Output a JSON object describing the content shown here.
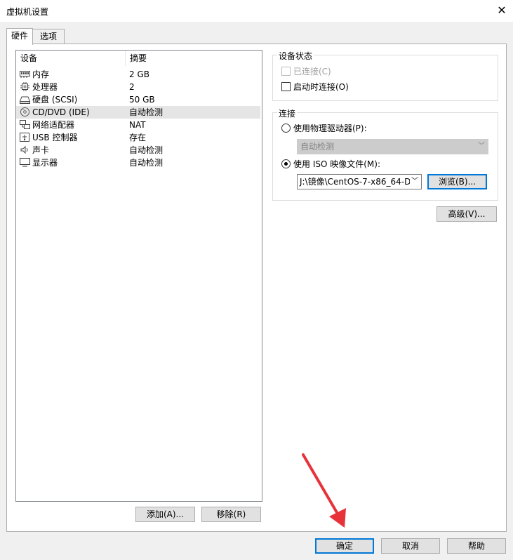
{
  "window": {
    "title": "虚拟机设置"
  },
  "tabs": [
    {
      "label": "硬件"
    },
    {
      "label": "选项"
    }
  ],
  "device_list": {
    "columns": [
      "设备",
      "摘要"
    ],
    "rows": [
      {
        "device": "内存",
        "summary": "2 GB",
        "icon": "memory-icon"
      },
      {
        "device": "处理器",
        "summary": "2",
        "icon": "processor-icon"
      },
      {
        "device": "硬盘 (SCSI)",
        "summary": "50 GB",
        "icon": "harddisk-icon"
      },
      {
        "device": "CD/DVD (IDE)",
        "summary": "自动检测",
        "icon": "cd-dvd-icon"
      },
      {
        "device": "网络适配器",
        "summary": "NAT",
        "icon": "network-adapter-icon"
      },
      {
        "device": "USB 控制器",
        "summary": "存在",
        "icon": "usb-icon"
      },
      {
        "device": "声卡",
        "summary": "自动检测",
        "icon": "speaker-icon"
      },
      {
        "device": "显示器",
        "summary": "自动检测",
        "icon": "monitor-icon"
      }
    ],
    "add_button": "添加(A)...",
    "remove_button": "移除(R)"
  },
  "device_status": {
    "title": "设备状态",
    "connected_label": "已连接(C)",
    "connect_on_power_label": "启动时连接(O)"
  },
  "connection": {
    "title": "连接",
    "physical_drive_label": "使用物理驱动器(P):",
    "physical_drive_value": "自动检测",
    "iso_label": "使用 ISO 映像文件(M):",
    "iso_path": "J:\\镜像\\CentOS-7-x86_64-D",
    "browse_button": "浏览(B)..."
  },
  "advanced_button": "高级(V)...",
  "footer": {
    "ok": "确定",
    "cancel": "取消",
    "help": "帮助"
  },
  "colors": {
    "arrow": "#e8323a",
    "focus": "#0078d7"
  }
}
